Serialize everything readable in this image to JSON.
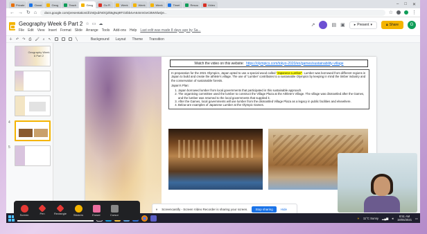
{
  "browser": {
    "tabs": [
      {
        "label": "Private",
        "color": "#e8710a",
        "active": false
      },
      {
        "label": "Classi",
        "color": "#1a73e8",
        "active": false
      },
      {
        "label": "Geog",
        "color": "#f4b400",
        "active": false
      },
      {
        "label": "Teach",
        "color": "#0f9d58",
        "active": false
      },
      {
        "label": "Geog",
        "color": "#f4b400",
        "active": true
      },
      {
        "label": "Go Fl",
        "color": "#d93025",
        "active": false
      },
      {
        "label": "Week",
        "color": "#f4b400",
        "active": false
      },
      {
        "label": "Week",
        "color": "#f4b400",
        "active": false
      },
      {
        "label": "Week",
        "color": "#f4b400",
        "active": false
      },
      {
        "label": "Timet",
        "color": "#1a73e8",
        "active": false
      },
      {
        "label": "Resou",
        "color": "#0f9d58",
        "active": false
      },
      {
        "label": "Video",
        "color": "#d93025",
        "active": false
      }
    ],
    "url": "docs.google.com/presentation/d/1NQxdrNOQZk6gNqI9TO2bb4vA64nmGeCBWSlwQe...",
    "window_controls": [
      "–",
      "□",
      "✕"
    ]
  },
  "docs": {
    "title": "Geography Week 6 Part 2",
    "menus": [
      "File",
      "Edit",
      "View",
      "Insert",
      "Format",
      "Slide",
      "Arrange",
      "Tools",
      "Add-ons",
      "Help"
    ],
    "last_edit": "Last edit was made 8 days ago by Sa...",
    "present_label": "Present",
    "share_label": "Share",
    "avatar_letter": "G",
    "toolbar_items": [
      "Background",
      "Layout",
      "Theme",
      "Transition"
    ]
  },
  "filmstrip": {
    "slides": [
      {
        "num": "",
        "caption": "Geography Week 6 Part 2"
      },
      {
        "num": "",
        "caption": ""
      },
      {
        "num": "",
        "caption": ""
      },
      {
        "num": "4",
        "caption": ""
      },
      {
        "num": "5",
        "caption": ""
      }
    ]
  },
  "slide": {
    "watch_label": "Watch the video on this website:",
    "watch_link": "https://olympics.com/tokyo-2020/en/games/sustainability-village",
    "intro_pre": "In preparation for the 2021 Olympics, Japan opted to use a special wood called ",
    "intro_highlight": "\"Japanese Lumber\"",
    "intro_post": ". Lumber was borrowed from different regions in Japan to build and create the athlete's village. The use of 'Lumber' contributes to a sustainable Olympics by keeping in mind the timber industry and the conservation of sustainable forests.",
    "steps_heading": "Japan's Plan:",
    "steps": [
      "Japan borrowed lumber from local governments that participated in this sustainable approach.",
      "The organising committee used the lumber to construct the Village Plaza at the Athlete's Village. The village was dismantled after the Games, and the lumber was returned to the local governments that supplied it.",
      "After the Games, local governments will use lumber from the dismantled Village Plaza as a legacy in public facilities and elsewhere.",
      "Below are examples of Japanese Lumber at the Olympic Games."
    ]
  },
  "recorder": {
    "buttons": [
      "Screen",
      "Pen",
      "Rectangle",
      "Stickers",
      "Eraser",
      "Cursor"
    ]
  },
  "sharing": {
    "message": "Screencastify - Screen Video Recorder is sharing your screen.",
    "stop_label": "Stop sharing",
    "hide_label": "Hide"
  },
  "taskbar": {
    "search_placeholder": "Type here to search",
    "weather": "11°C Sunny",
    "time": "8:51 AM",
    "date": "19/05/2021"
  }
}
